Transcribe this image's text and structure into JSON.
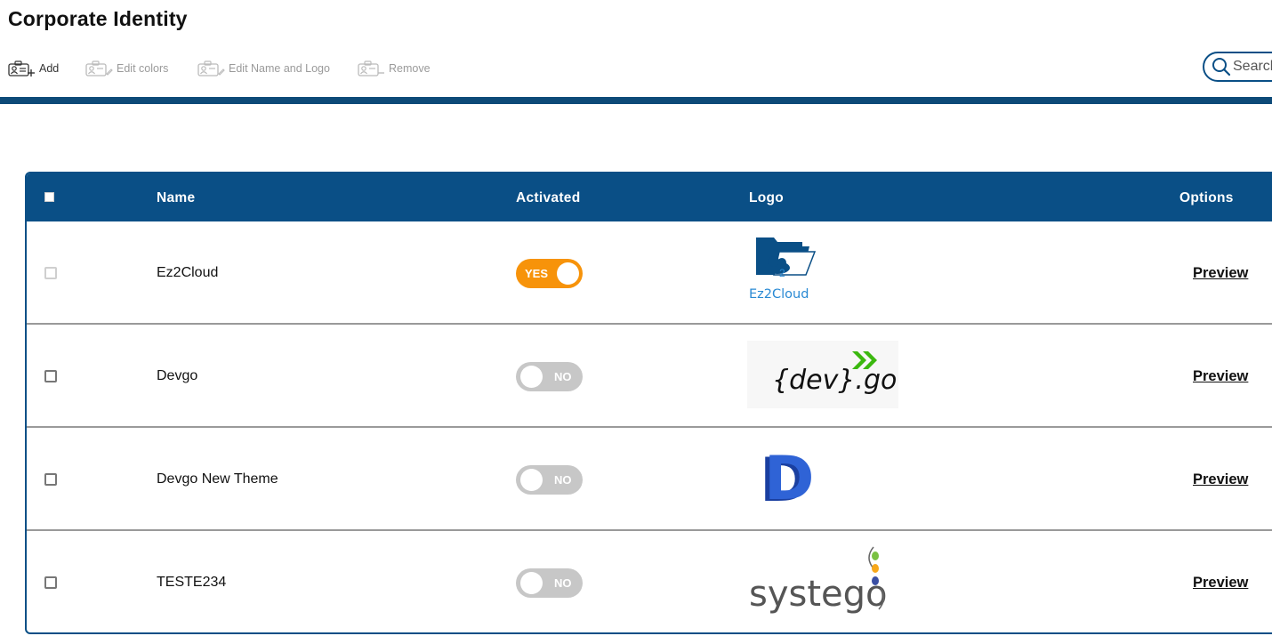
{
  "page": {
    "title": "Corporate Identity"
  },
  "toolbar": {
    "add_label": "Add",
    "edit_colors_label": "Edit colors",
    "edit_name_logo_label": "Edit Name and Logo",
    "remove_label": "Remove"
  },
  "search": {
    "placeholder": "Search"
  },
  "table": {
    "headers": {
      "name": "Name",
      "activated": "Activated",
      "logo": "Logo",
      "options": "Options"
    },
    "rows": [
      {
        "name": "Ez2Cloud",
        "activated": "YES",
        "logo_text": "Ez2Cloud",
        "option": "Preview"
      },
      {
        "name": "Devgo",
        "activated": "NO",
        "logo_text": "{dev}.go",
        "option": "Preview"
      },
      {
        "name": "Devgo New Theme",
        "activated": "NO",
        "logo_text": "D",
        "option": "Preview"
      },
      {
        "name": "TESTE234",
        "activated": "NO",
        "logo_text": "systego",
        "option": "Preview"
      }
    ]
  },
  "colors": {
    "header_blue": "#0a4f86",
    "toggle_on": "#f7930a",
    "toggle_off": "#c7c7c7"
  }
}
